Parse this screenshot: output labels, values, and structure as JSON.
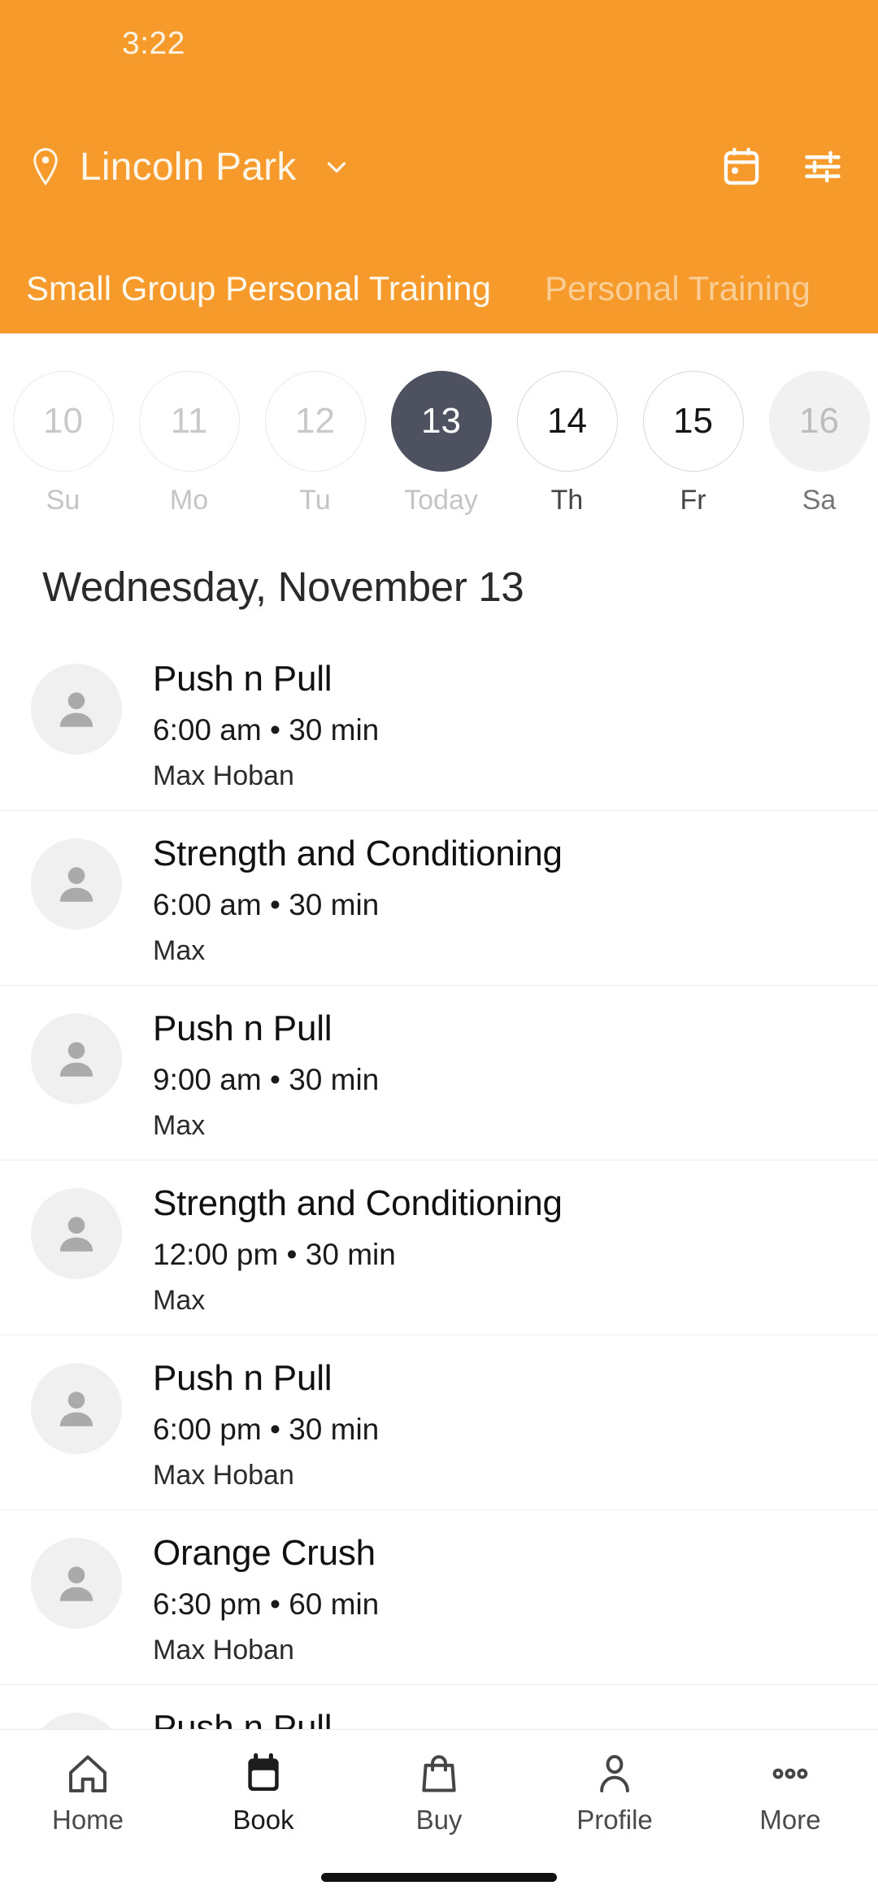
{
  "colors": {
    "brand_orange": "#F59A2B",
    "selected_day": "#4E5160",
    "avatar_bg": "#F0F0F0",
    "text_primary": "#101010"
  },
  "status_bar": {
    "time": "3:22"
  },
  "header": {
    "location_name": "Lincoln Park",
    "pin_icon": "location-pin-icon",
    "chevron_icon": "chevron-down-icon",
    "calendar_icon": "calendar-icon",
    "filter_icon": "filter-sliders-icon"
  },
  "tabs": [
    {
      "label": "Small Group Personal Training",
      "active": true
    },
    {
      "label": "Personal Training",
      "active": false
    }
  ],
  "date_strip": [
    {
      "day_number": "10",
      "day_label": "Su",
      "state": "past"
    },
    {
      "day_number": "11",
      "day_label": "Mo",
      "state": "past"
    },
    {
      "day_number": "12",
      "day_label": "Tu",
      "state": "past"
    },
    {
      "day_number": "13",
      "day_label": "Today",
      "state": "selected"
    },
    {
      "day_number": "14",
      "day_label": "Th",
      "state": "future"
    },
    {
      "day_number": "15",
      "day_label": "Fr",
      "state": "future"
    },
    {
      "day_number": "16",
      "day_label": "Sa",
      "state": "filled"
    }
  ],
  "date_header": "Wednesday, November 13",
  "classes": [
    {
      "title": "Push n Pull",
      "meta": "6:00 am • 30 min",
      "coach": "Max Hoban",
      "avatar_icon": "person-placeholder-icon"
    },
    {
      "title": "Strength and Conditioning",
      "meta": "6:00 am • 30 min",
      "coach": "Max",
      "avatar_icon": "person-placeholder-icon"
    },
    {
      "title": "Push n Pull",
      "meta": "9:00 am • 30 min",
      "coach": "Max",
      "avatar_icon": "person-placeholder-icon"
    },
    {
      "title": "Strength and Conditioning",
      "meta": "12:00 pm • 30 min",
      "coach": "Max",
      "avatar_icon": "person-placeholder-icon"
    },
    {
      "title": "Push n Pull",
      "meta": "6:00 pm • 30 min",
      "coach": "Max Hoban",
      "avatar_icon": "person-placeholder-icon"
    },
    {
      "title": "Orange Crush",
      "meta": "6:30 pm • 60 min",
      "coach": "Max Hoban",
      "avatar_icon": "person-placeholder-icon"
    },
    {
      "title": "Push n Pull",
      "meta": "",
      "coach": "",
      "avatar_icon": "person-placeholder-icon"
    }
  ],
  "bottom_nav": [
    {
      "label": "Home",
      "icon": "home-icon",
      "active": false
    },
    {
      "label": "Book",
      "icon": "calendar-filled-icon",
      "active": true
    },
    {
      "label": "Buy",
      "icon": "shopping-bag-icon",
      "active": false
    },
    {
      "label": "Profile",
      "icon": "person-icon",
      "active": false
    },
    {
      "label": "More",
      "icon": "more-dots-icon",
      "active": false
    }
  ]
}
